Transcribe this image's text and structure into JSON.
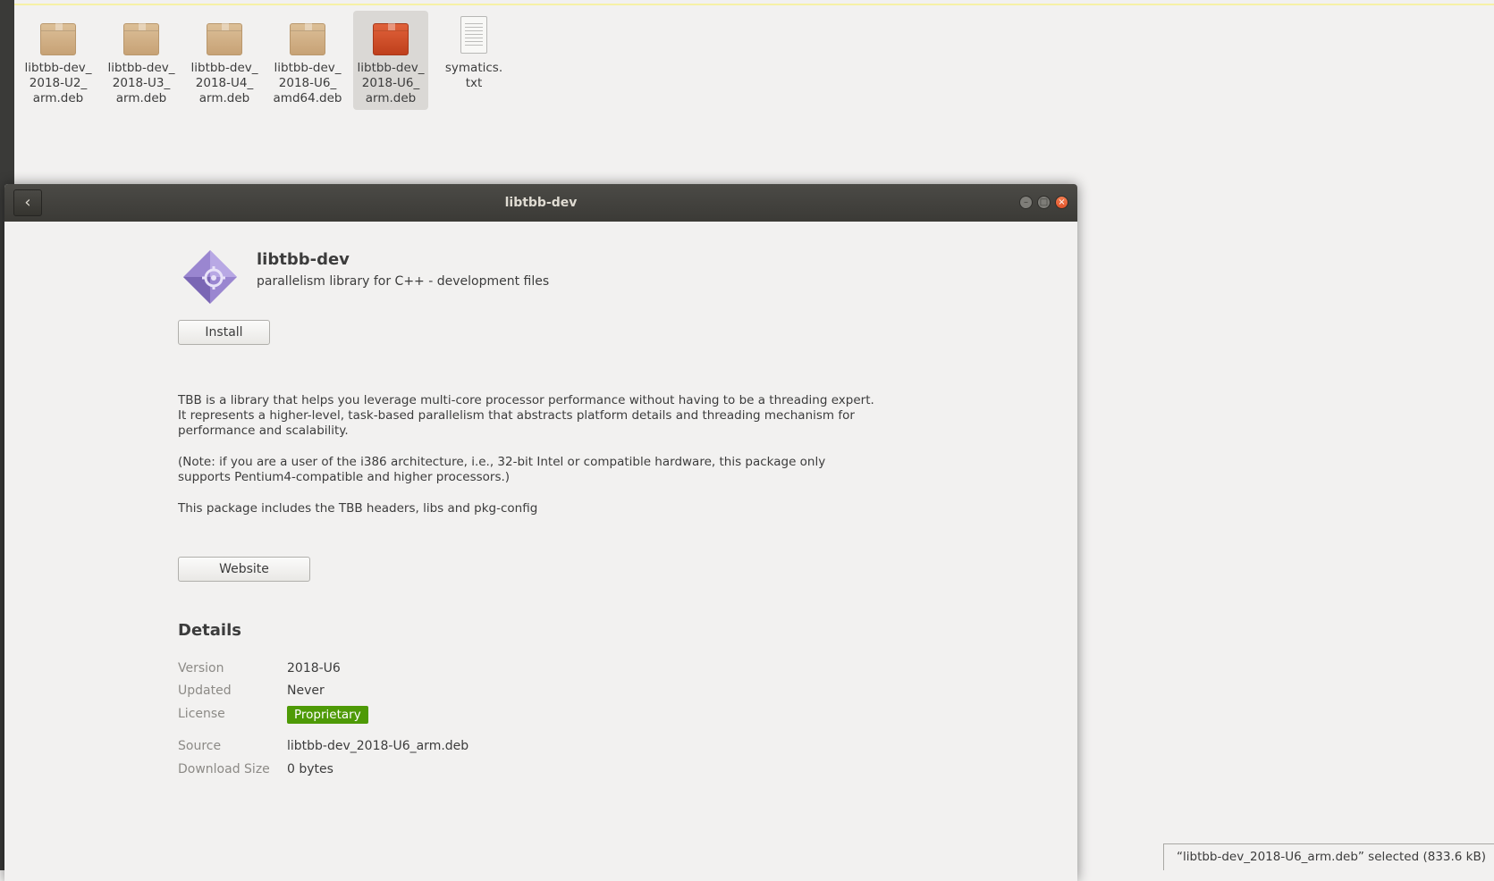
{
  "files": [
    {
      "label": "libtbb-dev_\n2018-U2_\narm.deb",
      "icon": "package-icon"
    },
    {
      "label": "libtbb-dev_\n2018-U3_\narm.deb",
      "icon": "package-icon"
    },
    {
      "label": "libtbb-dev_\n2018-U4_\narm.deb",
      "icon": "package-icon"
    },
    {
      "label": "libtbb-dev_\n2018-U6_\namd64.deb",
      "icon": "package-icon"
    },
    {
      "label": "libtbb-dev_\n2018-U6_\narm.deb",
      "icon": "package-icon-selected"
    },
    {
      "label": "symatics.\ntxt",
      "icon": "text-file-icon"
    }
  ],
  "dialog": {
    "title": "libtbb-dev",
    "back_icon": "‹",
    "app_name": "libtbb-dev",
    "app_summary": "parallelism library for C++ - development files",
    "install_label": "Install",
    "description": [
      "TBB is a library that helps you leverage multi-core processor performance without having to be a threading expert. It represents a higher-level, task-based parallelism that abstracts platform details and threading mechanism for performance and scalability.",
      "(Note: if you are a user of the i386 architecture, i.e., 32-bit Intel or compatible hardware, this package only supports Pentium4-compatible and higher processors.)",
      "This package includes the TBB headers, libs and pkg-config"
    ],
    "website_label": "Website",
    "details_heading": "Details",
    "details": {
      "version_key": "Version",
      "version_val": "2018-U6",
      "updated_key": "Updated",
      "updated_val": "Never",
      "license_key": "License",
      "license_val": "Proprietary",
      "source_key": "Source",
      "source_val": "libtbb-dev_2018-U6_arm.deb",
      "download_key": "Download Size",
      "download_val": "0 bytes"
    }
  },
  "status": {
    "text": "“libtbb-dev_2018-U6_arm.deb” selected  (833.6 kB)"
  },
  "colors": {
    "badge": "#4e9a06",
    "close_button": "#e1532a",
    "selected_package": "#bf3f1c"
  }
}
